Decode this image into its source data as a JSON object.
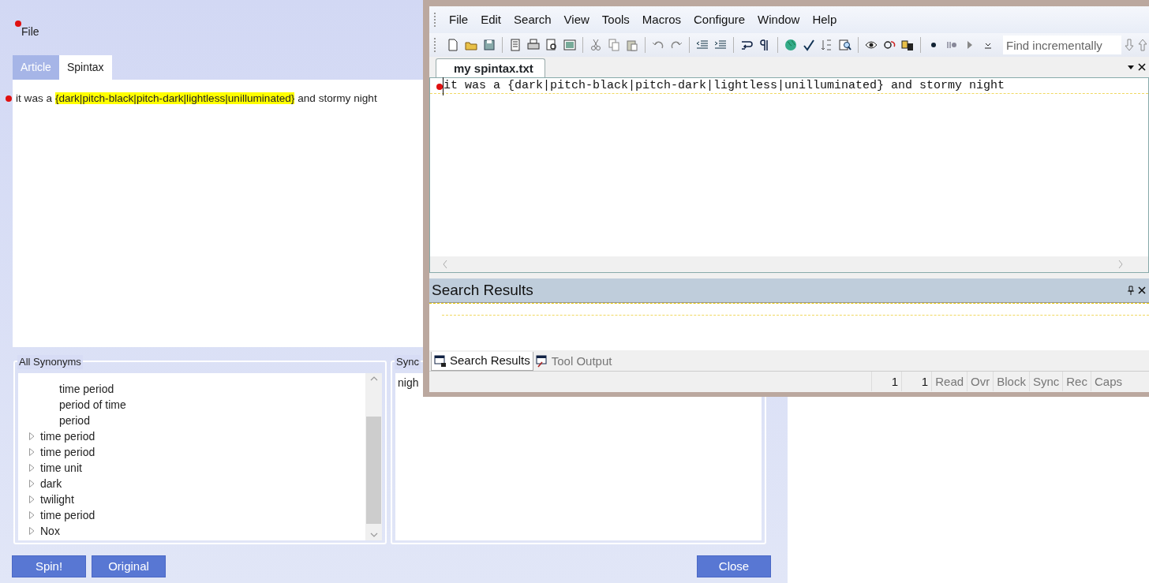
{
  "app": {
    "menu": [
      {
        "label": "File",
        "bookmarked": true
      }
    ],
    "tabs": [
      {
        "label": "Article",
        "selected": false
      },
      {
        "label": "Spintax",
        "selected": true
      }
    ],
    "article_line": {
      "bookmarked": true,
      "segments": [
        {
          "text": "it was a ",
          "highlighted": false
        },
        {
          "text": "{dark|pitch-black|pitch-dark|lightless|unilluminated}",
          "highlighted": true
        },
        {
          "text": " and stormy night",
          "highlighted": false
        }
      ]
    },
    "all_synonyms": {
      "title": "All Synonyms",
      "items": [
        {
          "children": [
            {
              "label": "time period"
            },
            {
              "label": "period of time"
            },
            {
              "label": "period"
            }
          ]
        },
        {
          "label": "time period",
          "expanded": false
        },
        {
          "label": "time period",
          "expanded": false
        },
        {
          "label": "time unit",
          "expanded": false
        },
        {
          "label": "dark",
          "expanded": false
        },
        {
          "label": "twilight",
          "expanded": false
        },
        {
          "label": "time period",
          "expanded": false
        },
        {
          "label": "Nox",
          "expanded": false
        }
      ]
    },
    "synonyms": {
      "title": "Sync",
      "items": [
        "nigh"
      ]
    },
    "buttons": [
      "Spin!",
      "Original",
      "Close"
    ]
  },
  "editor": {
    "menu": [
      "File",
      "Edit",
      "Search",
      "View",
      "Tools",
      "Macros",
      "Configure",
      "Window",
      "Help"
    ],
    "search": {
      "placeholder": "Find incrementally"
    },
    "doc_tabs": [
      {
        "label": "my spintax.txt",
        "selected": true
      }
    ],
    "lines": [
      {
        "text": "it was a {dark|pitch-black|pitch-dark|lightless|unilluminated} and stormy night",
        "bookmarked": true
      }
    ],
    "pane": {
      "title": "Search Results"
    },
    "pane_tabs": [
      {
        "label": "Search Results",
        "selected": true
      },
      {
        "label": "Tool Output",
        "selected": false
      }
    ],
    "status": [
      {
        "text": "1",
        "on": true
      },
      {
        "text": "1",
        "on": true
      },
      {
        "text": "Read",
        "on": false
      },
      {
        "text": "Ovr",
        "on": false
      },
      {
        "text": "Block",
        "on": false
      },
      {
        "text": "Sync",
        "on": false
      },
      {
        "text": "Rec",
        "on": false
      },
      {
        "text": "Caps",
        "on": false
      }
    ]
  }
}
